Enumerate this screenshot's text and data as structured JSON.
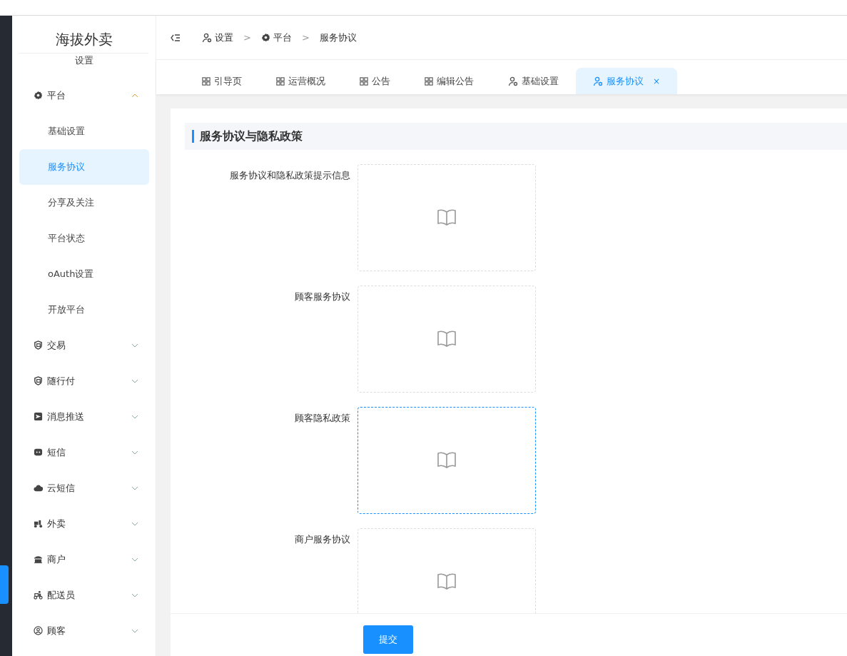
{
  "app": {
    "title": "海拔外卖",
    "section": "设置"
  },
  "sidebar": {
    "items": [
      {
        "label": "平台",
        "expanded": true,
        "children": [
          {
            "label": "基础设置",
            "selected": false
          },
          {
            "label": "服务协议",
            "selected": true
          },
          {
            "label": "分享及关注",
            "selected": false
          },
          {
            "label": "平台状态",
            "selected": false
          },
          {
            "label": "oAuth设置",
            "selected": false
          },
          {
            "label": "开放平台",
            "selected": false
          }
        ]
      },
      {
        "label": "交易",
        "expanded": false
      },
      {
        "label": "随行付",
        "expanded": false
      },
      {
        "label": "消息推送",
        "expanded": false
      },
      {
        "label": "短信",
        "expanded": false
      },
      {
        "label": "云短信",
        "expanded": false
      },
      {
        "label": "外卖",
        "expanded": false
      },
      {
        "label": "商户",
        "expanded": false
      },
      {
        "label": "配送员",
        "expanded": false
      },
      {
        "label": "顾客",
        "expanded": false
      }
    ]
  },
  "breadcrumb": [
    {
      "label": "设置"
    },
    {
      "label": "平台"
    },
    {
      "label": "服务协议"
    }
  ],
  "breadcrumb_separator": ">",
  "tabs": [
    {
      "label": "引导页",
      "selected": false
    },
    {
      "label": "运营概况",
      "selected": false
    },
    {
      "label": "公告",
      "selected": false
    },
    {
      "label": "编辑公告",
      "selected": false
    },
    {
      "label": "基础设置",
      "selected": false
    },
    {
      "label": "服务协议",
      "selected": true,
      "close": "×"
    }
  ],
  "section_title": "服务协议与隐私政策",
  "fields": [
    {
      "label": "服务协议和隐私政策提示信息",
      "focused": false
    },
    {
      "label": "顾客服务协议",
      "focused": false
    },
    {
      "label": "顾客隐私政策",
      "focused": true
    },
    {
      "label": "商户服务协议",
      "focused": false
    }
  ],
  "submit_button": "提交"
}
